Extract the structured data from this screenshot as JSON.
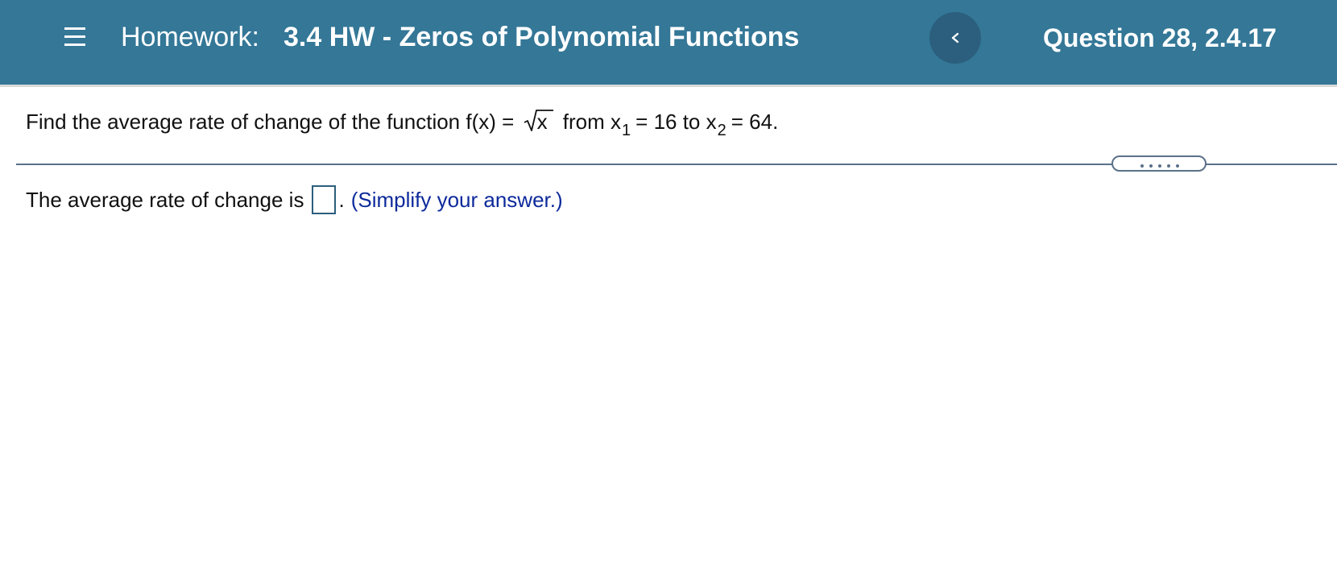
{
  "header": {
    "label": "Homework:",
    "title": "3.4 HW - Zeros of Polynomial Functions",
    "question": "Question 28, 2.4.17",
    "menu_icon": "hamburger-menu-icon",
    "prev_icon": "chevron-left-icon"
  },
  "question": {
    "prefix": "Find the average rate of change of the function f(x) =",
    "radicand": "x",
    "from_text": "from x",
    "x1_sub": "1",
    "x1_equals": "= 16 to x",
    "x2_sub": "2",
    "x2_equals": "= 64."
  },
  "answer": {
    "prompt": "The average rate of change is",
    "value": "",
    "period": ".",
    "hint": "(Simplify your answer.)"
  },
  "colors": {
    "header_bg": "#347797",
    "prev_button_bg": "#2b5f7d",
    "hint_text": "#0d2a9b",
    "divider": "#5b7189"
  }
}
